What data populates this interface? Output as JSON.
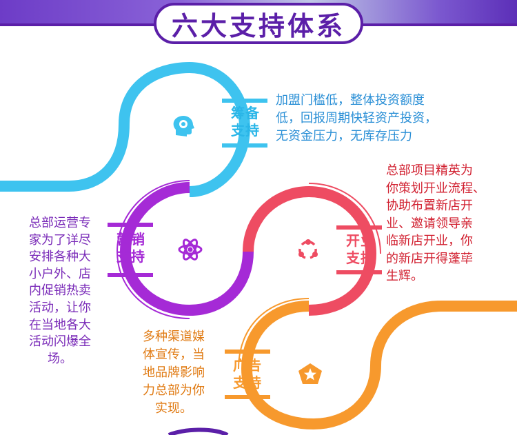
{
  "header": {
    "title": "六大支持体系"
  },
  "colors": {
    "title": "#5b1fa8",
    "blue": "#3ec3ef",
    "purple": "#a52ad6",
    "red": "#ee4c62",
    "orange": "#f7992d",
    "label_blue": "#2ab6e8",
    "desc_blue": "#2a8fd6",
    "desc_purple": "#7a2bb8",
    "desc_red": "#d11f2f",
    "desc_orange": "#e07a12"
  },
  "items": [
    {
      "key": "prepare",
      "label_line1": "筹备",
      "label_line2": "支持",
      "icon": "head-idea-icon",
      "desc": [
        "加盟门槛低，整体投资额度",
        "低，回报周期快轻资产投资，",
        "无资金压力，无库存压力"
      ]
    },
    {
      "key": "operation",
      "label_line1": "营销",
      "label_line2": "支持",
      "icon": "atom-icon",
      "desc": [
        "总部运营专",
        "家为了详尽",
        "安排各种大",
        "小户外、店",
        "内促销热卖",
        "活动，让你",
        "在当地各大",
        "活动闪爆全",
        "场。"
      ]
    },
    {
      "key": "opening",
      "label_line1": "开业",
      "label_line2": "支持",
      "icon": "share-cycle-icon",
      "desc": [
        "总部项目精英为",
        "你策划开业流程、",
        "协助布置新店开",
        "业、邀请领导亲",
        "临新店开业，你",
        "的新店开得蓬荜",
        "生辉。"
      ]
    },
    {
      "key": "advert",
      "label_line1": "广告",
      "label_line2": "支持",
      "icon": "star-badge-icon",
      "desc": [
        "多种渠道媒",
        "体宣传，当",
        "地品牌影响",
        "力总部为你",
        "实现。"
      ]
    }
  ]
}
